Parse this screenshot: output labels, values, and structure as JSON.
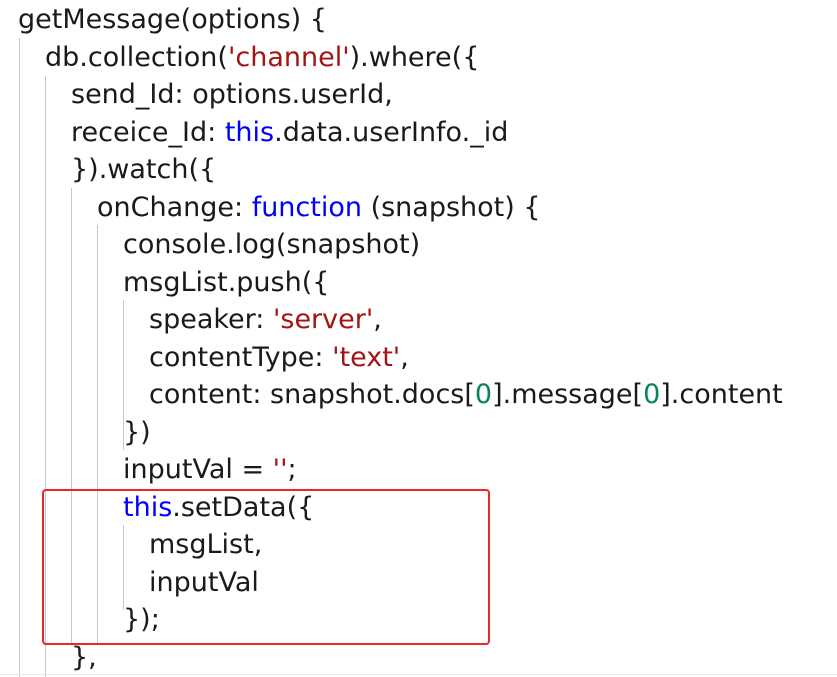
{
  "editor": {
    "lines": [
      {
        "tokens": [
          {
            "t": "getMessage(options) {",
            "c": "plain"
          }
        ]
      },
      {
        "tokens": [
          {
            "t": "db.collection(",
            "c": "plain"
          },
          {
            "t": "'channel'",
            "c": "str"
          },
          {
            "t": ").where({",
            "c": "plain"
          }
        ]
      },
      {
        "tokens": [
          {
            "t": "send_Id: options.userId,",
            "c": "plain"
          }
        ]
      },
      {
        "tokens": [
          {
            "t": "receice_Id: ",
            "c": "plain"
          },
          {
            "t": "this",
            "c": "kw"
          },
          {
            "t": ".data.userInfo._id",
            "c": "plain"
          }
        ]
      },
      {
        "tokens": [
          {
            "t": "}).watch({",
            "c": "plain"
          }
        ]
      },
      {
        "tokens": [
          {
            "t": "onChange: ",
            "c": "plain"
          },
          {
            "t": "function",
            "c": "kw"
          },
          {
            "t": " (snapshot) {",
            "c": "plain"
          }
        ]
      },
      {
        "tokens": [
          {
            "t": "console.log(snapshot)",
            "c": "plain"
          }
        ]
      },
      {
        "tokens": [
          {
            "t": "msgList.push({",
            "c": "plain"
          }
        ]
      },
      {
        "tokens": [
          {
            "t": "speaker: ",
            "c": "plain"
          },
          {
            "t": "'server'",
            "c": "str"
          },
          {
            "t": ",",
            "c": "plain"
          }
        ]
      },
      {
        "tokens": [
          {
            "t": "contentType: ",
            "c": "plain"
          },
          {
            "t": "'text'",
            "c": "str"
          },
          {
            "t": ",",
            "c": "plain"
          }
        ]
      },
      {
        "tokens": [
          {
            "t": "content: snapshot.docs[",
            "c": "plain"
          },
          {
            "t": "0",
            "c": "num"
          },
          {
            "t": "].message[",
            "c": "plain"
          },
          {
            "t": "0",
            "c": "num"
          },
          {
            "t": "].content",
            "c": "plain"
          }
        ]
      },
      {
        "tokens": [
          {
            "t": "})",
            "c": "plain"
          }
        ]
      },
      {
        "tokens": [
          {
            "t": "inputVal = ",
            "c": "plain"
          },
          {
            "t": "''",
            "c": "str"
          },
          {
            "t": ";",
            "c": "plain"
          }
        ]
      },
      {
        "tokens": [
          {
            "t": "this",
            "c": "kw"
          },
          {
            "t": ".setData({",
            "c": "plain"
          }
        ]
      },
      {
        "tokens": [
          {
            "t": "msgList,",
            "c": "plain"
          }
        ]
      },
      {
        "tokens": [
          {
            "t": "inputVal",
            "c": "plain"
          }
        ]
      },
      {
        "tokens": [
          {
            "t": "});",
            "c": "plain"
          }
        ]
      },
      {
        "tokens": [
          {
            "t": "},",
            "c": "plain"
          }
        ]
      }
    ]
  },
  "colors": {
    "keyword": "#0000ff",
    "string": "#a31515",
    "number": "#098658",
    "plain": "#1a1a1a",
    "highlight_border": "#e8282b",
    "indent_guide": "#c8c8c8"
  }
}
